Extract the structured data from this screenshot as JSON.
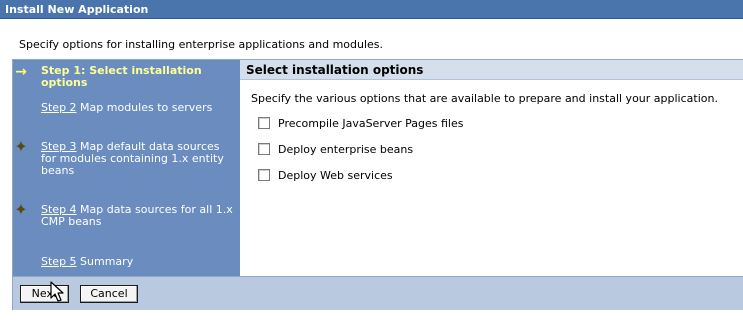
{
  "window": {
    "title": "Install New Application"
  },
  "intro_text": "Specify options for installing enterprise applications and modules.",
  "steps": [
    {
      "marker": "arrow-icon",
      "link": "Step 1: Select installation options",
      "rest": ""
    },
    {
      "marker": "",
      "link": "Step 2",
      "rest": " Map modules to servers"
    },
    {
      "marker": "star-icon",
      "link": "Step 3",
      "rest": " Map default data sources for modules containing 1.x entity beans"
    },
    {
      "marker": "star-icon",
      "link": "Step 4",
      "rest": " Map data sources for all 1.x CMP beans"
    },
    {
      "marker": "",
      "link": "Step 5",
      "rest": " Summary"
    }
  ],
  "content": {
    "header": "Select installation options",
    "description": "Specify the various options that are available to prepare and install your application.",
    "options": [
      {
        "label": "Precompile JavaServer Pages files",
        "checked": false
      },
      {
        "label": "Deploy enterprise beans",
        "checked": false
      },
      {
        "label": "Deploy Web services",
        "checked": false
      }
    ]
  },
  "buttons": {
    "next_label": "Next",
    "cancel_label": "Cancel"
  },
  "colors": {
    "title_bar": "#4a74ac",
    "step_panel": "#6a8cbf",
    "active_step_text": "#ffff99",
    "content_header": "#d5dfec",
    "button_bar": "#b8c9e0"
  }
}
